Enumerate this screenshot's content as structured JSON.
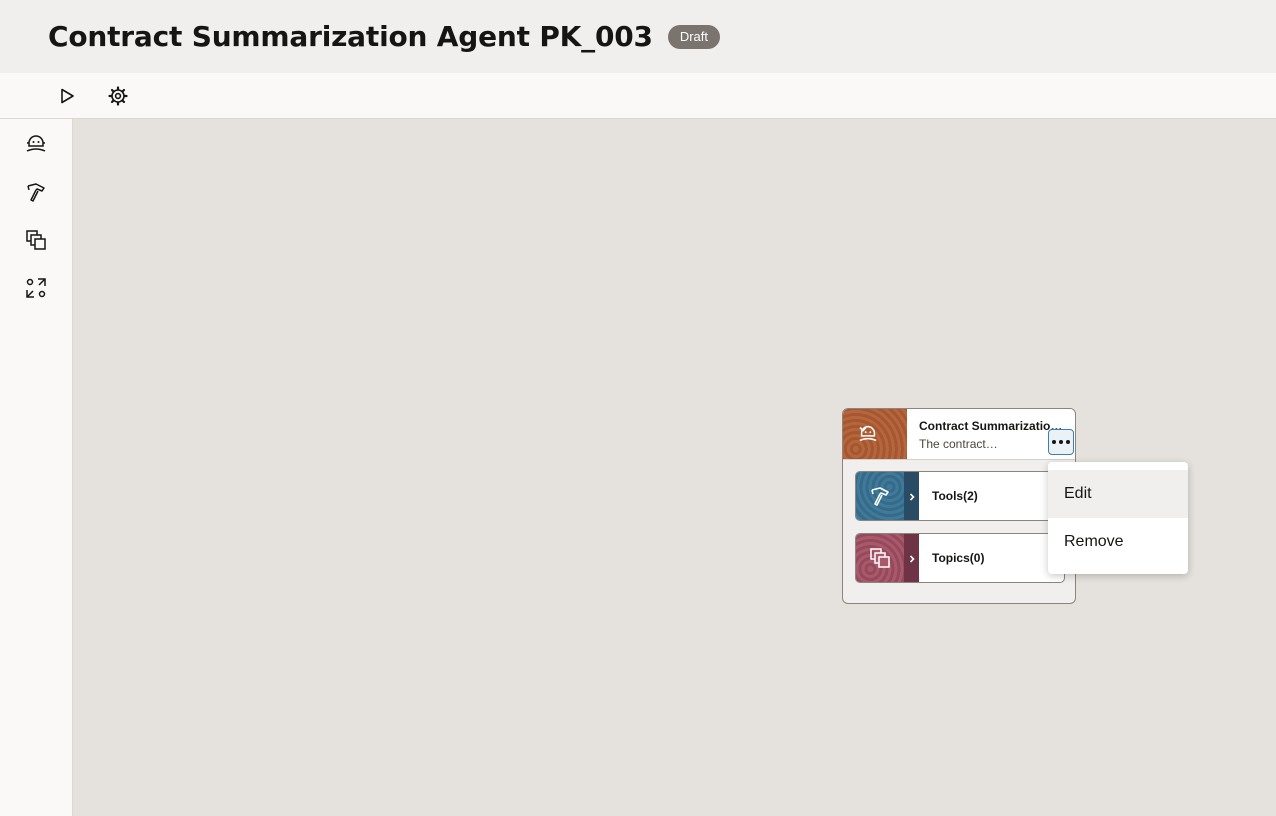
{
  "header": {
    "title": "Contract Summarization Agent PK_003",
    "status": "Draft"
  },
  "toolbar": {
    "run_icon": "play-icon",
    "settings_icon": "gear-icon"
  },
  "sidebar": {
    "items": [
      {
        "icon": "agent-icon"
      },
      {
        "icon": "tools-hammer-icon"
      },
      {
        "icon": "topics-icon"
      },
      {
        "icon": "workflow-icon"
      }
    ]
  },
  "agent_node": {
    "title": "Contract Summarization Agent PK_003",
    "description": "The contract…",
    "colors": {
      "agent": "#b7653a",
      "tools": "#3f7a9a",
      "topics": "#a85a6c"
    }
  },
  "tools_node": {
    "label": "Tools(2)"
  },
  "topics_node": {
    "label": "Topics(0)"
  },
  "context_menu": {
    "items": [
      "Edit",
      "Remove"
    ]
  }
}
